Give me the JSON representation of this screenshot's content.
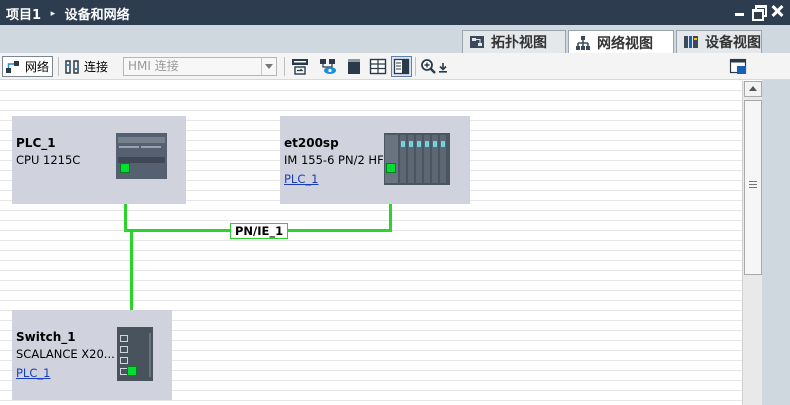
{
  "titlebar": {
    "project": "项目1",
    "separator": "▸",
    "section": "设备和网络"
  },
  "tabs": [
    {
      "label": "拓扑视图",
      "icon": "topology-view-icon",
      "active": false
    },
    {
      "label": "网络视图",
      "icon": "network-view-icon",
      "active": true
    },
    {
      "label": "设备视图",
      "icon": "device-view-icon",
      "active": false
    }
  ],
  "toolbar": {
    "network_label": "网络",
    "connect_label": "连接",
    "connection_type": "HMI 连接",
    "icons": [
      "name-display-icon",
      "highlight-icon",
      "device-icon",
      "table-icon",
      "overview-icon",
      "zoom-icon",
      "export-icon"
    ]
  },
  "devices": [
    {
      "name": "PLC_1",
      "type": "CPU 1215C",
      "link": ""
    },
    {
      "name": "et200sp",
      "type": "IM 155-6 PN/2 HF",
      "link": "PLC_1"
    },
    {
      "name": "Switch_1",
      "type": "SCALANCE X20...",
      "link": "PLC_1"
    }
  ],
  "network": {
    "subnet_label": "PN/IE_1",
    "line_color": "#2bd42b"
  },
  "colors": {
    "titlebar": "#2d3d4f",
    "device_box": "#d0d3dd",
    "port_green": "#00dd33",
    "link_blue": "#1a3fb5"
  }
}
